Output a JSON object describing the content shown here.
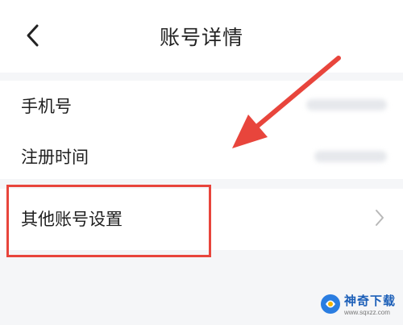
{
  "header": {
    "title": "账号详情",
    "back_icon": "chevron-left-icon"
  },
  "rows": [
    {
      "label": "手机号"
    },
    {
      "label": "注册时间"
    }
  ],
  "other_account": {
    "label": "其他账号设置",
    "chevron_icon": "chevron-right-icon"
  },
  "colors": {
    "annotation_red": "#e8453c",
    "text": "#1f1f1f",
    "background": "#f5f6f8",
    "watermark_blue": "#1c5fb8"
  },
  "watermark": {
    "name": "神奇下载",
    "url": "www.sqxzz.com"
  }
}
